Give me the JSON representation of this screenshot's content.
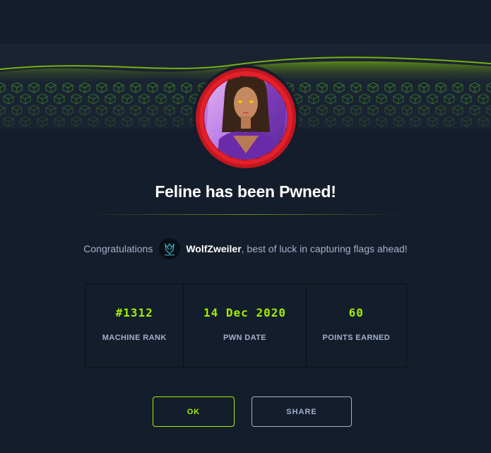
{
  "machine": {
    "name": "Feline"
  },
  "title": "Feline has been Pwned!",
  "congrats": {
    "prefix": "Congratulations",
    "username": "WolfZweiler",
    "suffix": ", best of luck in capturing flags ahead!"
  },
  "stats": [
    {
      "value": "#1312",
      "label": "MACHINE RANK"
    },
    {
      "value": "14 Dec 2020",
      "label": "PWN DATE"
    },
    {
      "value": "60",
      "label": "POINTS EARNED"
    }
  ],
  "buttons": {
    "ok": "OK",
    "share": "SHARE"
  },
  "colors": {
    "background": "#141d2b",
    "accent": "#9fef00",
    "muted": "#a4b1cd",
    "avatar_ring": "#e3202b"
  },
  "icons": {
    "user_avatar": "wolf-avatar-icon",
    "machine_avatar": "feline-machine-avatar"
  }
}
